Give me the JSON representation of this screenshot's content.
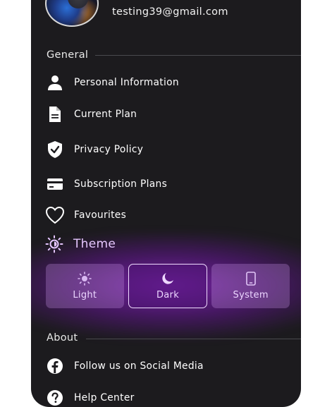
{
  "profile": {
    "email": "testing39@gmail.com"
  },
  "general": {
    "title": "General",
    "items": [
      {
        "label": "Personal Information",
        "icon": "person-icon"
      },
      {
        "label": "Current Plan",
        "icon": "document-icon"
      },
      {
        "label": "Privacy Policy",
        "icon": "shield-check-icon"
      },
      {
        "label": "Subscription Plans",
        "icon": "credit-card-icon"
      },
      {
        "label": "Favourites",
        "icon": "heart-icon"
      }
    ]
  },
  "theme": {
    "title": "Theme",
    "icon": "sun-icon",
    "options": [
      {
        "label": "Light",
        "icon": "sun-icon",
        "selected": false
      },
      {
        "label": "Dark",
        "icon": "moon-icon",
        "selected": true
      },
      {
        "label": "System",
        "icon": "phone-icon",
        "selected": false
      }
    ]
  },
  "about": {
    "title": "About",
    "items": [
      {
        "label": "Follow us on Social Media",
        "icon": "facebook-icon"
      },
      {
        "label": "Help Center",
        "icon": "question-icon"
      }
    ]
  },
  "colors": {
    "background": "#1c1b1e",
    "accent": "#e6c6ff",
    "glow": "#9628d2"
  }
}
